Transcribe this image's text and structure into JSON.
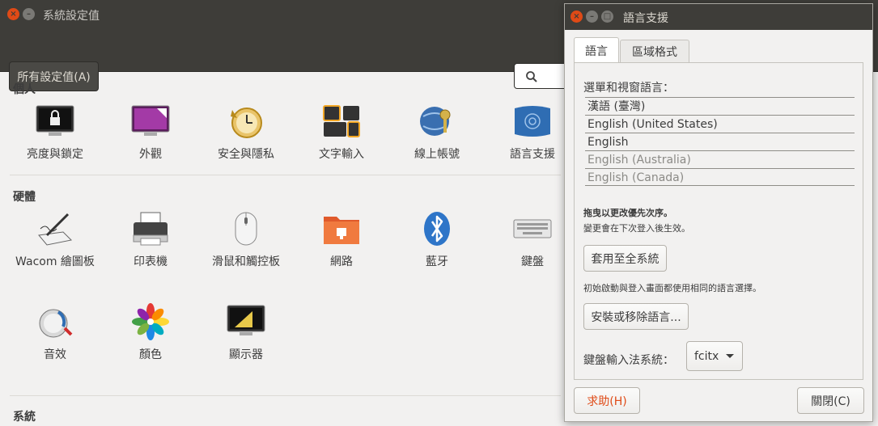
{
  "settings_window": {
    "title": "系統設定值",
    "all_settings_label": "所有設定值(A)",
    "sections": [
      {
        "title": "個人",
        "items": [
          {
            "label": "亮度與鎖定",
            "icon": "lock-screen-icon"
          },
          {
            "label": "外觀",
            "icon": "appearance-icon"
          },
          {
            "label": "安全與隱私",
            "icon": "security-privacy-icon"
          },
          {
            "label": "文字輸入",
            "icon": "text-entry-icon"
          },
          {
            "label": "線上帳號",
            "icon": "online-accounts-icon"
          },
          {
            "label": "語言支援",
            "icon": "language-support-icon"
          }
        ]
      },
      {
        "title": "硬體",
        "items": [
          {
            "label": "Wacom 繪圖板",
            "icon": "wacom-tablet-icon"
          },
          {
            "label": "印表機",
            "icon": "printer-icon"
          },
          {
            "label": "滑鼠和觸控板",
            "icon": "mouse-icon"
          },
          {
            "label": "網路",
            "icon": "network-folder-icon"
          },
          {
            "label": "藍牙",
            "icon": "bluetooth-icon"
          },
          {
            "label": "鍵盤",
            "icon": "keyboard-icon"
          },
          {
            "label": "音效",
            "icon": "sound-icon"
          },
          {
            "label": "顏色",
            "icon": "color-icon"
          },
          {
            "label": "顯示器",
            "icon": "display-icon"
          }
        ]
      },
      {
        "title": "系統",
        "items": []
      }
    ]
  },
  "language_dialog": {
    "title": "語言支援",
    "tabs": [
      "語言",
      "區域格式"
    ],
    "menu_language_label": "選單和視窗語言：",
    "languages": [
      {
        "name": "漢語 (臺灣)",
        "active": true
      },
      {
        "name": "English (United States)",
        "active": true
      },
      {
        "name": "English",
        "active": true
      },
      {
        "name": "English (Australia)",
        "active": false
      },
      {
        "name": "English (Canada)",
        "active": false
      }
    ],
    "drag_hint": "拖曳以更改優先次序。",
    "change_note": "變更會在下次登入後生效。",
    "apply_button": "套用至全系統",
    "init_note": "初始啟動與登入畫面都使用相同的語言選擇。",
    "install_button": "安裝或移除語言...",
    "keyboard_input_label": "鍵盤輸入法系統：",
    "keyboard_input_value": "fcitx",
    "help_button": "求助(H)",
    "close_button": "關閉(C)"
  }
}
